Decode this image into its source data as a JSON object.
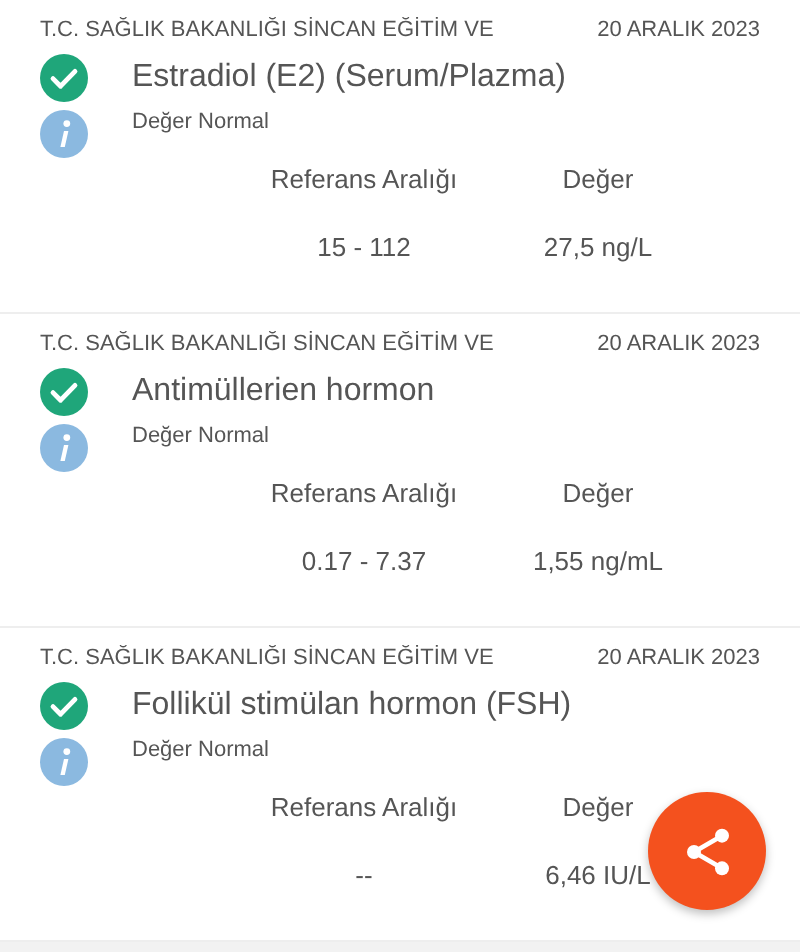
{
  "results": [
    {
      "institution": "T.C. SAĞLIK BAKANLIĞI SİNCAN EĞİTİM VE",
      "date": "20 ARALIK 2023",
      "test": "Estradiol (E2) (Serum/Plazma)",
      "normal": true,
      "note": "Değer Normal",
      "range_label": "Referans Aralığı",
      "value_label": "Değer",
      "range": "15 - 112",
      "value": "27,5 ng/L"
    },
    {
      "institution": "T.C. SAĞLIK BAKANLIĞI SİNCAN EĞİTİM VE",
      "date": "20 ARALIK 2023",
      "test": "Antimüllerien hormon",
      "normal": true,
      "note": "Değer Normal",
      "range_label": "Referans Aralığı",
      "value_label": "Değer",
      "range": "0.17 - 7.37",
      "value": "1,55 ng/mL"
    },
    {
      "institution": "T.C. SAĞLIK BAKANLIĞI SİNCAN EĞİTİM VE",
      "date": "20 ARALIK 2023",
      "test": "Follikül stimülan hormon (FSH)",
      "normal": true,
      "note": "Değer Normal",
      "range_label": "Referans Aralığı",
      "value_label": "Değer",
      "range": "--",
      "value": "6,46 IU/L"
    }
  ]
}
